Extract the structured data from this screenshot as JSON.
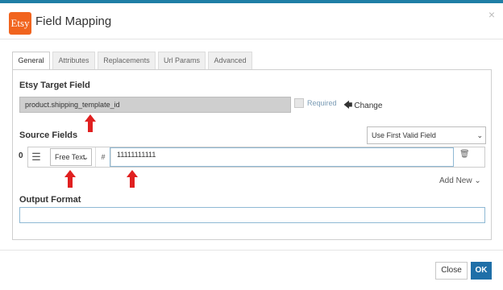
{
  "dialog": {
    "title": "Field Mapping",
    "logo_text": "Etsy",
    "close_glyph": "×",
    "brand_color": "#f1641e",
    "accent_color": "#1f6fa8"
  },
  "tabs": [
    {
      "label": "General",
      "active": true
    },
    {
      "label": "Attributes",
      "active": false
    },
    {
      "label": "Replacements",
      "active": false
    },
    {
      "label": "Url Params",
      "active": false
    },
    {
      "label": "Advanced",
      "active": false
    }
  ],
  "target_field": {
    "heading": "Etsy Target Field",
    "value": "product.shipping_template_id",
    "required_label": "Required",
    "change_label": "Change"
  },
  "source_fields": {
    "heading": "Source Fields",
    "strategy_select": "Use First Valid Field",
    "rows": [
      {
        "index": "0",
        "type_select": "Free Text",
        "prefix": "#",
        "value": "11111111111"
      }
    ],
    "add_new_label": "Add New"
  },
  "output_format": {
    "heading": "Output Format",
    "value": ""
  },
  "footer": {
    "close_label": "Close",
    "ok_label": "OK"
  },
  "annotation_color": "#e02020",
  "icons": [
    "etsy-logo",
    "close-icon",
    "arrow-left-icon",
    "hamburger-icon",
    "trash-icon",
    "chevron-down-icon",
    "red-arrow-annotation"
  ]
}
